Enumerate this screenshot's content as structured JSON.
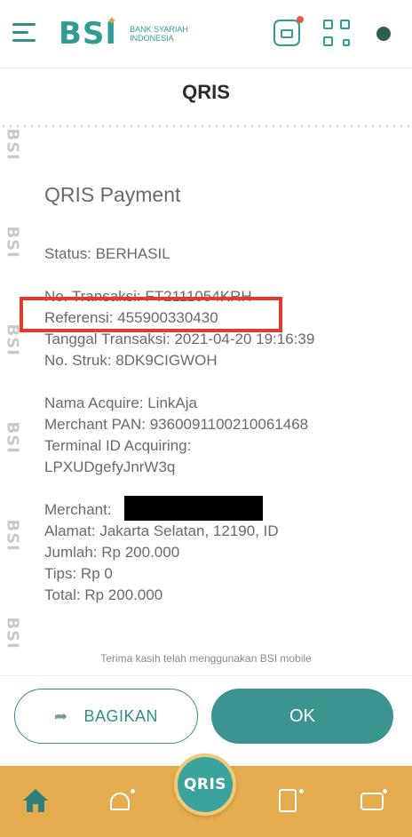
{
  "app": {
    "logo": "BSI",
    "logo_subtitle_1": "BANK SYARIAH",
    "logo_subtitle_2": "INDONESIA",
    "page_title": "QRIS"
  },
  "receipt": {
    "heading": "QRIS Payment",
    "status": "Status: BERHASIL",
    "no_transaksi": "No. Transaksi: FT2111054KRH",
    "referensi": "Referensi: 455900330430",
    "tanggal": "Tanggal Transaksi: 2021-04-20 19:16:39",
    "no_struk": "No. Struk: 8DK9CIGWOH",
    "nama_acquire": "Nama Acquire: LinkAja",
    "merchant_pan": "Merchant PAN: 936009110021006146​8",
    "terminal_label": "Terminal ID Acquiring:",
    "terminal_value": "LPXUDgefyJnrW3q",
    "merchant_label": "Merchant:",
    "alamat": "Alamat: Jakarta Selatan, 12190, ID",
    "jumlah": "Jumlah: Rp 200.000",
    "tips": "Tips: Rp 0",
    "total": "Total: Rp 200.000",
    "thanks": "Terima kasih telah menggunakan BSI mobile",
    "watermark": "BSI"
  },
  "actions": {
    "share_label": "BAGIKAN",
    "ok_label": "OK"
  },
  "bottom_nav": {
    "fab_label": "QRIS"
  },
  "colors": {
    "brand_teal": "#3b948f",
    "brand_gold": "#e4ac4e",
    "highlight_red": "#e33b2e"
  }
}
